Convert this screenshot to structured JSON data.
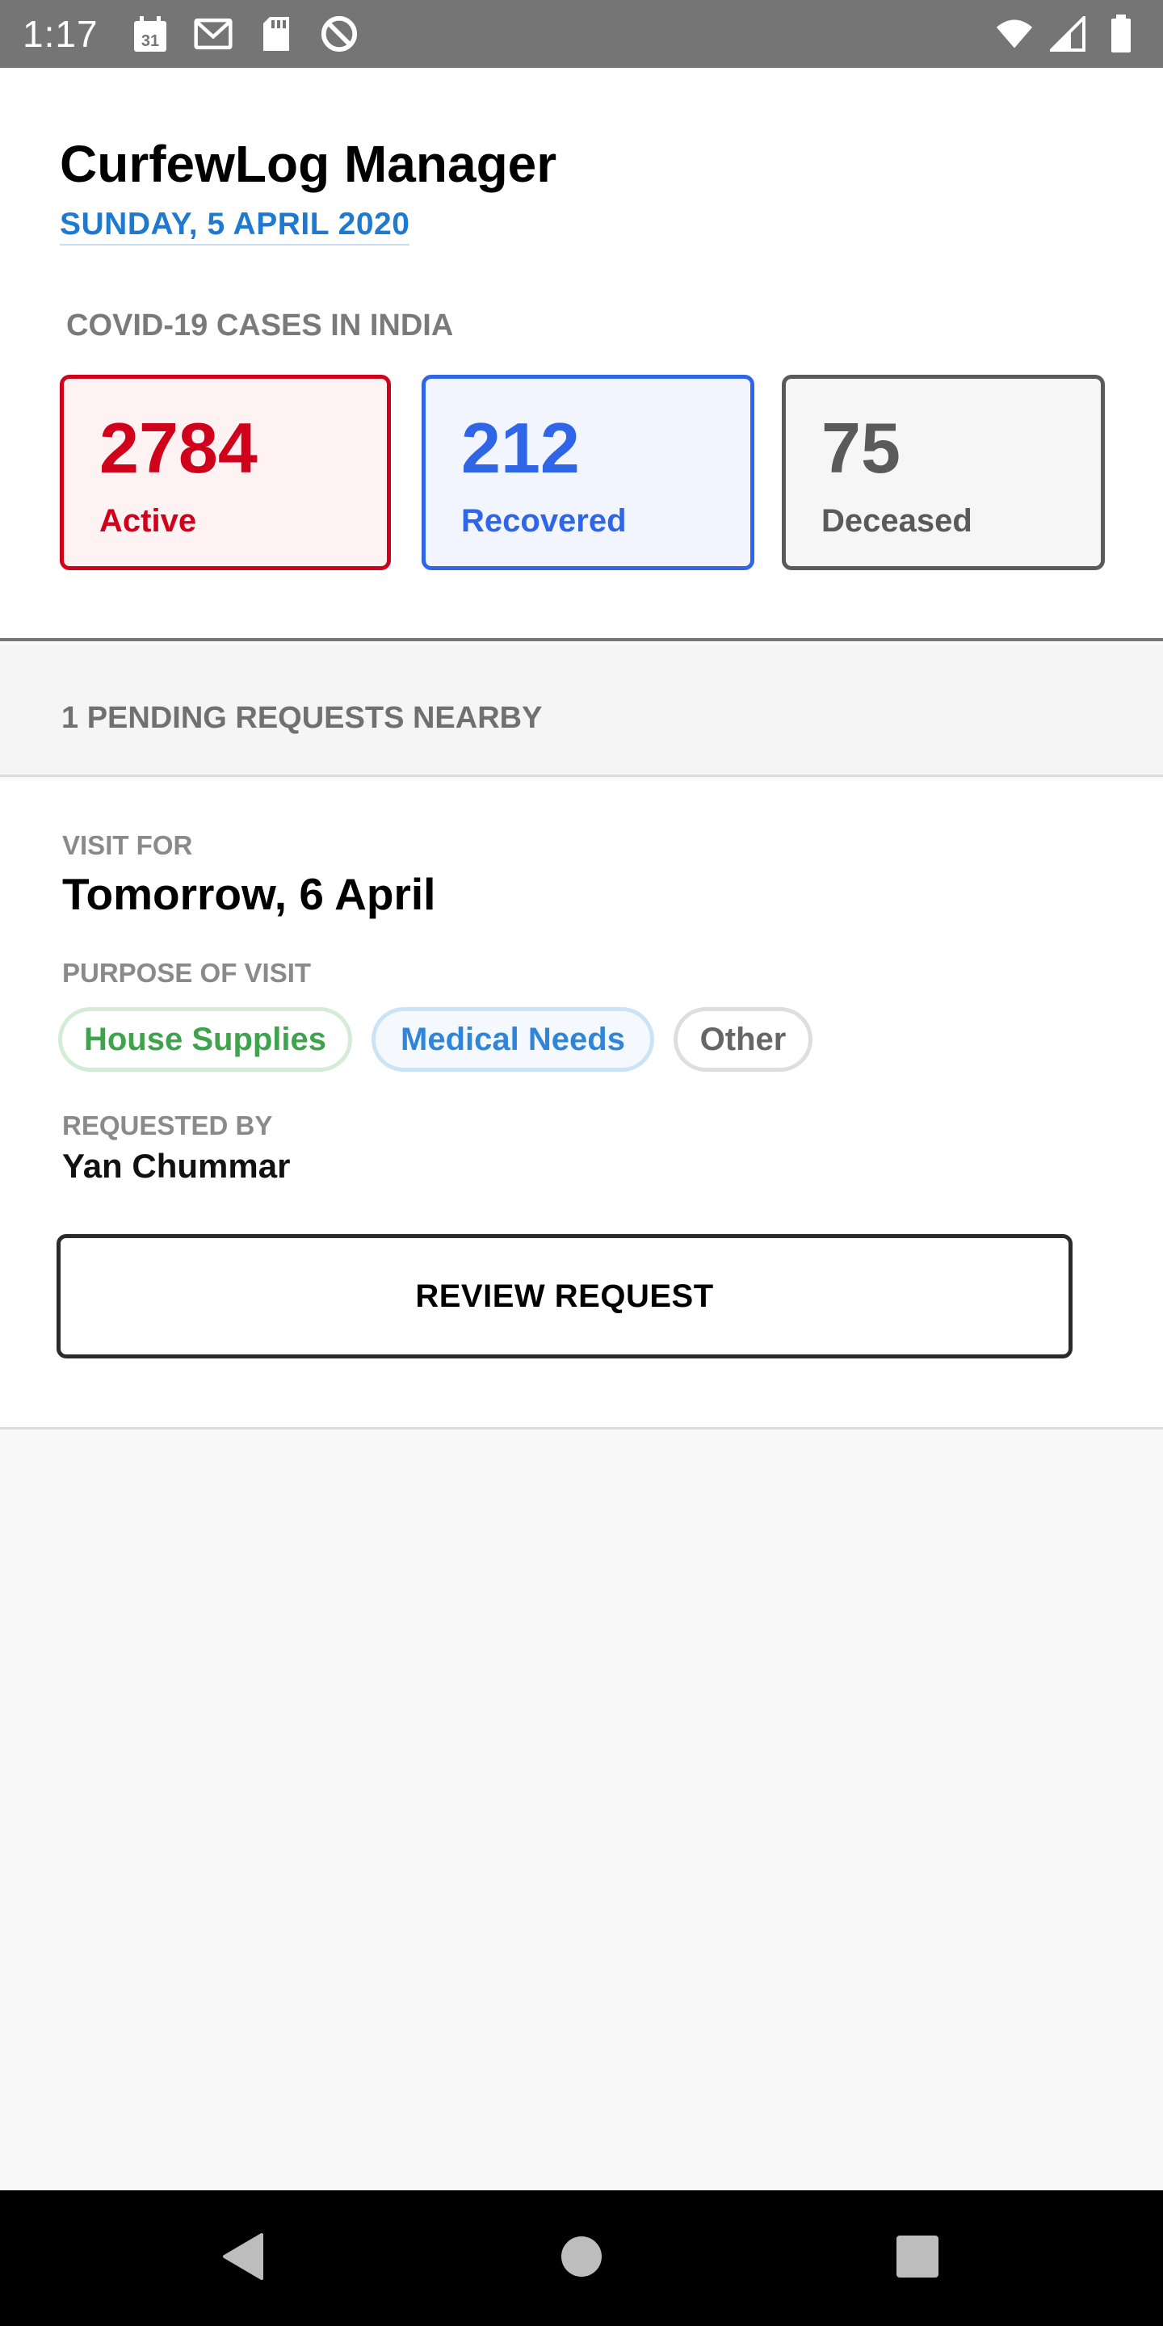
{
  "status_bar": {
    "time": "1:17",
    "calendar_day": "31",
    "icons_left": [
      "calendar-icon",
      "gmail-icon",
      "sd-card-icon",
      "do-not-disturb-icon"
    ],
    "icons_right": [
      "wifi-icon",
      "signal-icon",
      "battery-icon"
    ]
  },
  "header": {
    "title": "CurfewLog Manager",
    "date": "SUNDAY, 5 APRIL 2020"
  },
  "cases": {
    "title": "COVID-19 CASES IN INDIA",
    "active": {
      "value": "2784",
      "label": "Active",
      "color": "#d0021b"
    },
    "recovered": {
      "value": "212",
      "label": "Recovered",
      "color": "#2f66e8"
    },
    "deceased": {
      "value": "75",
      "label": "Deceased",
      "color": "#5a5a5a"
    }
  },
  "pending": {
    "title": "1 PENDING REQUESTS NEARBY"
  },
  "request": {
    "visit_for_label": "VISIT FOR",
    "visit_for_value": "Tomorrow, 6 April",
    "purpose_label": "PURPOSE OF VISIT",
    "purposes": [
      "House Supplies",
      "Medical Needs",
      "Other"
    ],
    "requested_by_label": "REQUESTED BY",
    "requested_by_value": "Yan Chummar",
    "review_button": "REVIEW REQUEST"
  },
  "nav_bar": {
    "icons": [
      "back-icon",
      "home-icon",
      "recents-icon"
    ]
  }
}
